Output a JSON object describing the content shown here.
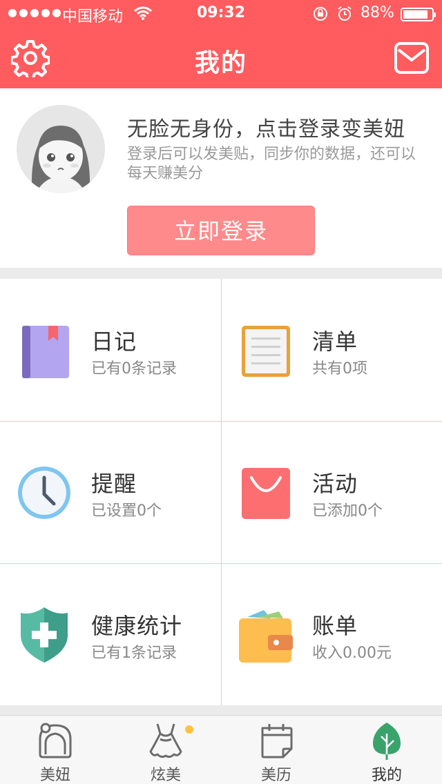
{
  "status_bar": {
    "carrier": "中国移动",
    "time": "09:32",
    "battery": "88%",
    "battery_level": 0.88
  },
  "header": {
    "title": "我的",
    "left_icon": "gear-icon",
    "right_icon": "mail-icon"
  },
  "profile": {
    "headline": "无脸无身份，点击登录变美妞",
    "subline": "登录后可以发美贴，同步你的数据，还可以每天赚美分",
    "login_label": "立即登录"
  },
  "grid": {
    "items": [
      {
        "label": "日记",
        "sub": "已有0条记录",
        "icon": "diary-book-icon"
      },
      {
        "label": "清单",
        "sub": "共有0项",
        "icon": "checklist-icon"
      },
      {
        "label": "提醒",
        "sub": "已设置0个",
        "icon": "clock-icon"
      },
      {
        "label": "活动",
        "sub": "已添加0个",
        "icon": "shopping-bag-icon"
      },
      {
        "label": "健康统计",
        "sub": "已有1条记录",
        "icon": "health-shield-icon"
      },
      {
        "label": "账单",
        "sub": "收入0.00元",
        "icon": "wallet-icon"
      }
    ]
  },
  "tabbar": {
    "tabs": [
      {
        "label": "美妞",
        "icon": "girl-face-icon",
        "active": false
      },
      {
        "label": "炫美",
        "icon": "dress-icon",
        "active": false,
        "badge_dot": true
      },
      {
        "label": "美历",
        "icon": "calendar-icon",
        "active": false
      },
      {
        "label": "我的",
        "icon": "leaf-icon",
        "active": true
      }
    ]
  },
  "colors": {
    "accent": "#fe5c5f",
    "login_button": "#ff8a8b",
    "active_tab": "#3aa26b",
    "badge_dot": "#ffc23d"
  }
}
